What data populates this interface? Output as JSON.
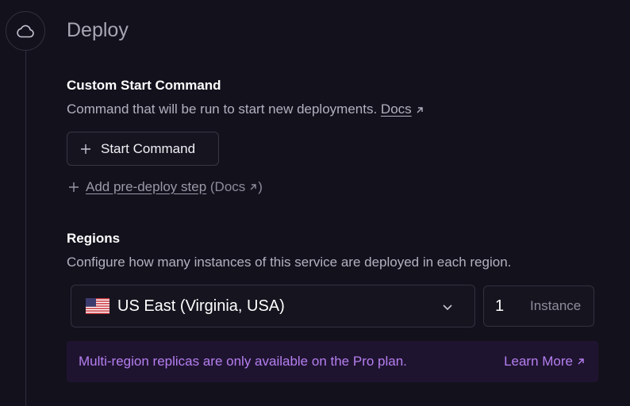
{
  "section": {
    "title": "Deploy",
    "icon": "cloud-icon"
  },
  "start_command": {
    "heading": "Custom Start Command",
    "description": "Command that will be run to start new deployments.",
    "docs_label": "Docs",
    "button_label": "Start Command"
  },
  "predeploy": {
    "link_label": "Add pre-deploy step",
    "docs_prefix": "(Docs",
    "docs_suffix": ")"
  },
  "regions": {
    "heading": "Regions",
    "description": "Configure how many instances of this service are deployed in each region.",
    "selected_region": "US East (Virginia, USA)",
    "flag": "us-flag-icon",
    "instance_count": "1",
    "instance_unit": "Instance"
  },
  "pro_banner": {
    "message": "Multi-region replicas are only available on the Pro plan.",
    "link_label": "Learn More"
  },
  "colors": {
    "background": "#13111c",
    "accent_purple": "#b57ff0",
    "banner_bg": "#1f1430"
  }
}
